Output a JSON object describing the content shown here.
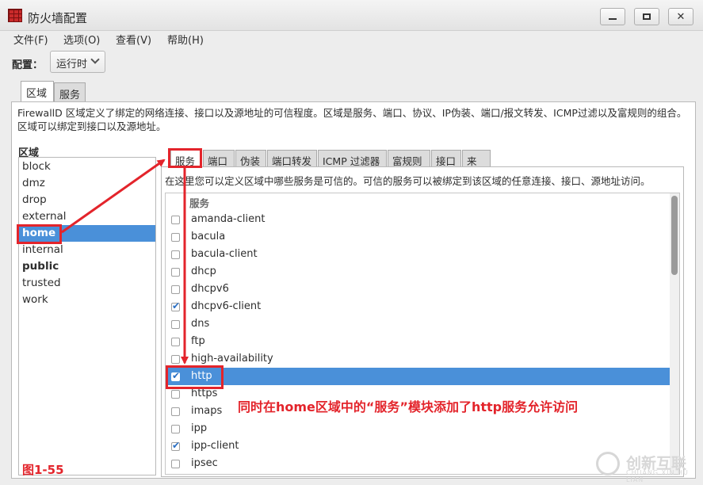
{
  "window": {
    "title": "防火墙配置",
    "minimize": "▢",
    "maximize": "▢",
    "close": "✕"
  },
  "menu": [
    "文件(F)",
    "选项(O)",
    "查看(V)",
    "帮助(H)"
  ],
  "config": {
    "label": "配置：",
    "value": "运行时"
  },
  "tabs": [
    "区域",
    "服务"
  ],
  "description": "FirewallD 区域定义了绑定的网络连接、接口以及源地址的可信程度。区域是服务、端口、协议、IP伪装、端口/报文转发、ICMP过滤以及富规则的组合。区域可以绑定到接口以及源地址。",
  "zones": {
    "header": "区域",
    "items": [
      {
        "name": "block",
        "selected": false,
        "bold": false
      },
      {
        "name": "dmz",
        "selected": false,
        "bold": false
      },
      {
        "name": "drop",
        "selected": false,
        "bold": false
      },
      {
        "name": "external",
        "selected": false,
        "bold": false
      },
      {
        "name": "home",
        "selected": true,
        "bold": true
      },
      {
        "name": "internal",
        "selected": false,
        "bold": false
      },
      {
        "name": "public",
        "selected": false,
        "bold": true
      },
      {
        "name": "trusted",
        "selected": false,
        "bold": false
      },
      {
        "name": "work",
        "selected": false,
        "bold": false
      }
    ]
  },
  "subtabs": [
    "服务",
    "端口",
    "伪装",
    "端口转发",
    "ICMP 过滤器",
    "富规则",
    "接口",
    "来源"
  ],
  "services": {
    "description": "在这里您可以定义区域中哪些服务是可信的。可信的服务可以被绑定到该区域的任意连接、接口、源地址访问。",
    "column_header": "服务",
    "items": [
      {
        "name": "amanda-client",
        "checked": false,
        "selected": false
      },
      {
        "name": "bacula",
        "checked": false,
        "selected": false
      },
      {
        "name": "bacula-client",
        "checked": false,
        "selected": false
      },
      {
        "name": "dhcp",
        "checked": false,
        "selected": false
      },
      {
        "name": "dhcpv6",
        "checked": false,
        "selected": false
      },
      {
        "name": "dhcpv6-client",
        "checked": true,
        "selected": false
      },
      {
        "name": "dns",
        "checked": false,
        "selected": false
      },
      {
        "name": "ftp",
        "checked": false,
        "selected": false
      },
      {
        "name": "high-availability",
        "checked": false,
        "selected": false
      },
      {
        "name": "http",
        "checked": true,
        "selected": true
      },
      {
        "name": "https",
        "checked": false,
        "selected": false
      },
      {
        "name": "imaps",
        "checked": false,
        "selected": false
      },
      {
        "name": "ipp",
        "checked": false,
        "selected": false
      },
      {
        "name": "ipp-client",
        "checked": true,
        "selected": false
      },
      {
        "name": "ipsec",
        "checked": false,
        "selected": false
      }
    ]
  },
  "annotation": "同时在home区域中的“服务”模块添加了http服务允许访问",
  "figure_label": "图1-55",
  "watermark": {
    "text": "创新互联",
    "sub": "CHUANG XIN HU LIAN"
  },
  "colors": {
    "selection": "#4a90d9",
    "annotation": "#e3242b"
  }
}
